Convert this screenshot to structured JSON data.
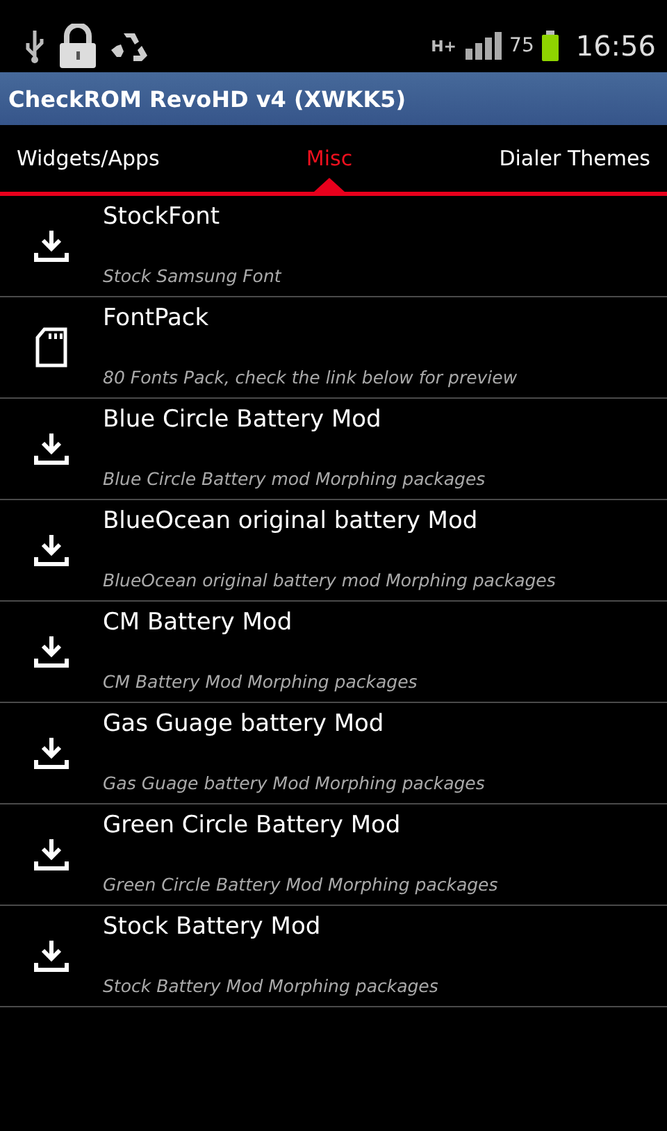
{
  "status_bar": {
    "network": "H+",
    "battery": "75",
    "time": "16:56"
  },
  "app_bar": {
    "title": "CheckROM RevoHD v4 (XWKK5)"
  },
  "tabs": [
    {
      "label": "Widgets/Apps",
      "selected": false
    },
    {
      "label": "Misc",
      "selected": true
    },
    {
      "label": "Dialer Themes",
      "selected": false
    }
  ],
  "items": [
    {
      "kind": "download",
      "title": "StockFont",
      "subtitle": "Stock Samsung Font"
    },
    {
      "kind": "sdcard",
      "title": "FontPack",
      "subtitle": "80 Fonts Pack, check the link below for preview"
    },
    {
      "kind": "download",
      "title": "Blue Circle Battery Mod",
      "subtitle": "Blue Circle Battery mod Morphing packages"
    },
    {
      "kind": "download",
      "title": "BlueOcean original battery Mod",
      "subtitle": "BlueOcean original battery mod Morphing packages"
    },
    {
      "kind": "download",
      "title": "CM Battery Mod",
      "subtitle": "CM Battery Mod Morphing packages"
    },
    {
      "kind": "download",
      "title": "Gas Guage battery Mod",
      "subtitle": "Gas Guage battery Mod Morphing packages"
    },
    {
      "kind": "download",
      "title": "Green Circle Battery Mod",
      "subtitle": "Green Circle Battery Mod Morphing packages"
    },
    {
      "kind": "download",
      "title": "Stock Battery Mod",
      "subtitle": "Stock Battery Mod Morphing packages"
    }
  ]
}
